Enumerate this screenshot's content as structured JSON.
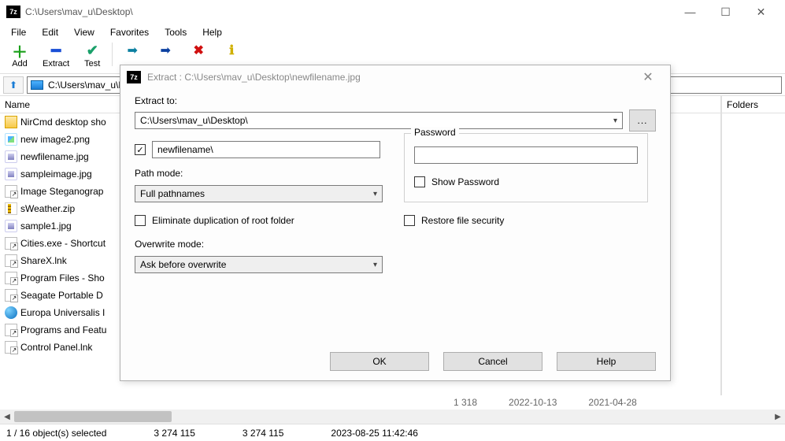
{
  "window": {
    "title": "C:\\Users\\mav_u\\Desktop\\",
    "app_glyph": "7z"
  },
  "menus": [
    "File",
    "Edit",
    "View",
    "Favorites",
    "Tools",
    "Help"
  ],
  "toolbar": {
    "add": "Add",
    "extract": "Extract",
    "test": "Test"
  },
  "pathbar": {
    "path": "C:\\Users\\mav_u\\Desktop\\"
  },
  "columns": {
    "name": "Name",
    "folders": "Folders"
  },
  "files": [
    {
      "name": "NirCmd desktop sho",
      "icon": "folder"
    },
    {
      "name": "new image2.png",
      "icon": "png"
    },
    {
      "name": "newfilename.jpg",
      "icon": "jpg"
    },
    {
      "name": "sampleimage.jpg",
      "icon": "jpg"
    },
    {
      "name": "Image Steganograp",
      "icon": "lnk"
    },
    {
      "name": "sWeather.zip",
      "icon": "zip"
    },
    {
      "name": "sample1.jpg",
      "icon": "jpg"
    },
    {
      "name": "Cities.exe - Shortcut",
      "icon": "lnk"
    },
    {
      "name": "ShareX.lnk",
      "icon": "lnk"
    },
    {
      "name": "Program Files - Sho",
      "icon": "lnk"
    },
    {
      "name": "Seagate Portable D",
      "icon": "lnk"
    },
    {
      "name": "Europa Universalis I",
      "icon": "globe"
    },
    {
      "name": "Programs and Featu",
      "icon": "lnk"
    },
    {
      "name": "Control Panel.lnk",
      "icon": "lnk"
    }
  ],
  "trunc_row": {
    "size": "1 318",
    "date1": "2022-10-13",
    "date2": "2021-04-28"
  },
  "status": {
    "selection": "1 / 16 object(s) selected",
    "size1": "3 274 115",
    "size2": "3 274 115",
    "timestamp": "2023-08-25 11:42:46"
  },
  "dialog": {
    "title": "Extract : C:\\Users\\mav_u\\Desktop\\newfilename.jpg",
    "extract_to_label": "Extract to:",
    "extract_to_value": "C:\\Users\\mav_u\\Desktop\\",
    "subfolder_checked": true,
    "subfolder_value": "newfilename\\",
    "pathmode_label": "Path mode:",
    "pathmode_value": "Full pathnames",
    "eliminate_label": "Eliminate duplication of root folder",
    "overwrite_label": "Overwrite mode:",
    "overwrite_value": "Ask before overwrite",
    "password_label": "Password",
    "show_password_label": "Show Password",
    "restore_label": "Restore file security",
    "ok": "OK",
    "cancel": "Cancel",
    "help": "Help",
    "browse_label": "..."
  }
}
